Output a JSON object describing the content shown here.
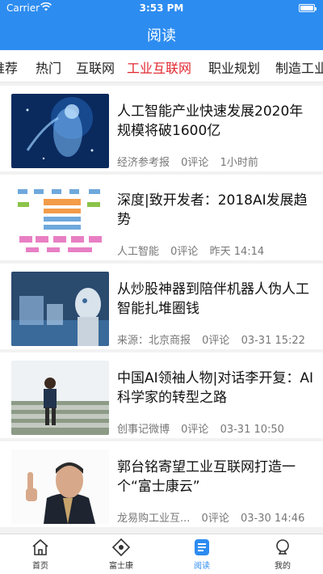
{
  "status": {
    "carrier": "Carrier",
    "time": "3:53 PM"
  },
  "header": {
    "title": "阅读"
  },
  "tabs": [
    {
      "label": "推荐"
    },
    {
      "label": "热门"
    },
    {
      "label": "互联网"
    },
    {
      "label": "工业互联网"
    },
    {
      "label": "职业规划"
    },
    {
      "label": "制造工业"
    }
  ],
  "active_tab": "工业互联网",
  "articles": [
    {
      "headline": "人工智能产业快速发展2020年规模将破1600亿",
      "source": "经济参考报",
      "comments": "0评论",
      "time": "1小时前"
    },
    {
      "headline": "深度|致开发者：2018AI发展趋势",
      "source": "人工智能",
      "comments": "0评论",
      "time": "昨天 14:14"
    },
    {
      "headline": "从炒股神器到陪伴机器人伪人工智能扎堆圈钱",
      "source": "来源：北京商报",
      "comments": "0评论",
      "time": "03-31 15:22"
    },
    {
      "headline": "中国AI领袖人物|对话李开复：AI科学家的转型之路",
      "source": "创事记微博",
      "comments": "0评论",
      "time": "03-31 10:50"
    },
    {
      "headline": "郭台铭寄望工业互联网打造一个“富士康云”",
      "source": "龙易购工业互...",
      "comments": "0评论",
      "time": "03-30 14:46"
    }
  ],
  "tabbar": [
    {
      "label": "首页",
      "icon": "home-icon"
    },
    {
      "label": "富士康",
      "icon": "diamond-icon"
    },
    {
      "label": "阅读",
      "icon": "reading-icon"
    },
    {
      "label": "我的",
      "icon": "profile-icon"
    }
  ],
  "colors": {
    "brand": "#2d8cf0",
    "active_tab": "#e0282f"
  }
}
